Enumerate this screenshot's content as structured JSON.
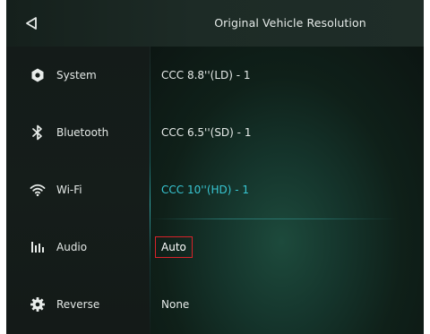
{
  "header": {
    "back_icon": "back-triangle-icon",
    "title": "Original Vehicle Resolution"
  },
  "sidebar": {
    "items": [
      {
        "label": "System",
        "icon": "gear-icon"
      },
      {
        "label": "Bluetooth",
        "icon": "bluetooth-icon"
      },
      {
        "label": "Wi-Fi",
        "icon": "wifi-icon"
      },
      {
        "label": "Audio",
        "icon": "equalizer-icon"
      },
      {
        "label": "Reverse",
        "icon": "gear-icon"
      }
    ]
  },
  "options": {
    "items": [
      {
        "label": "CCC 8.8''(LD) - 1"
      },
      {
        "label": "CCC 6.5''(SD) - 1"
      },
      {
        "label": "CCC 10''(HD) - 1"
      },
      {
        "label": "Auto"
      },
      {
        "label": "None"
      }
    ],
    "selected_index": 2,
    "highlighted_index": 3
  },
  "colors": {
    "selected_text": "#38c6d3",
    "highlight_border": "#d9232a",
    "background": "#101413"
  }
}
